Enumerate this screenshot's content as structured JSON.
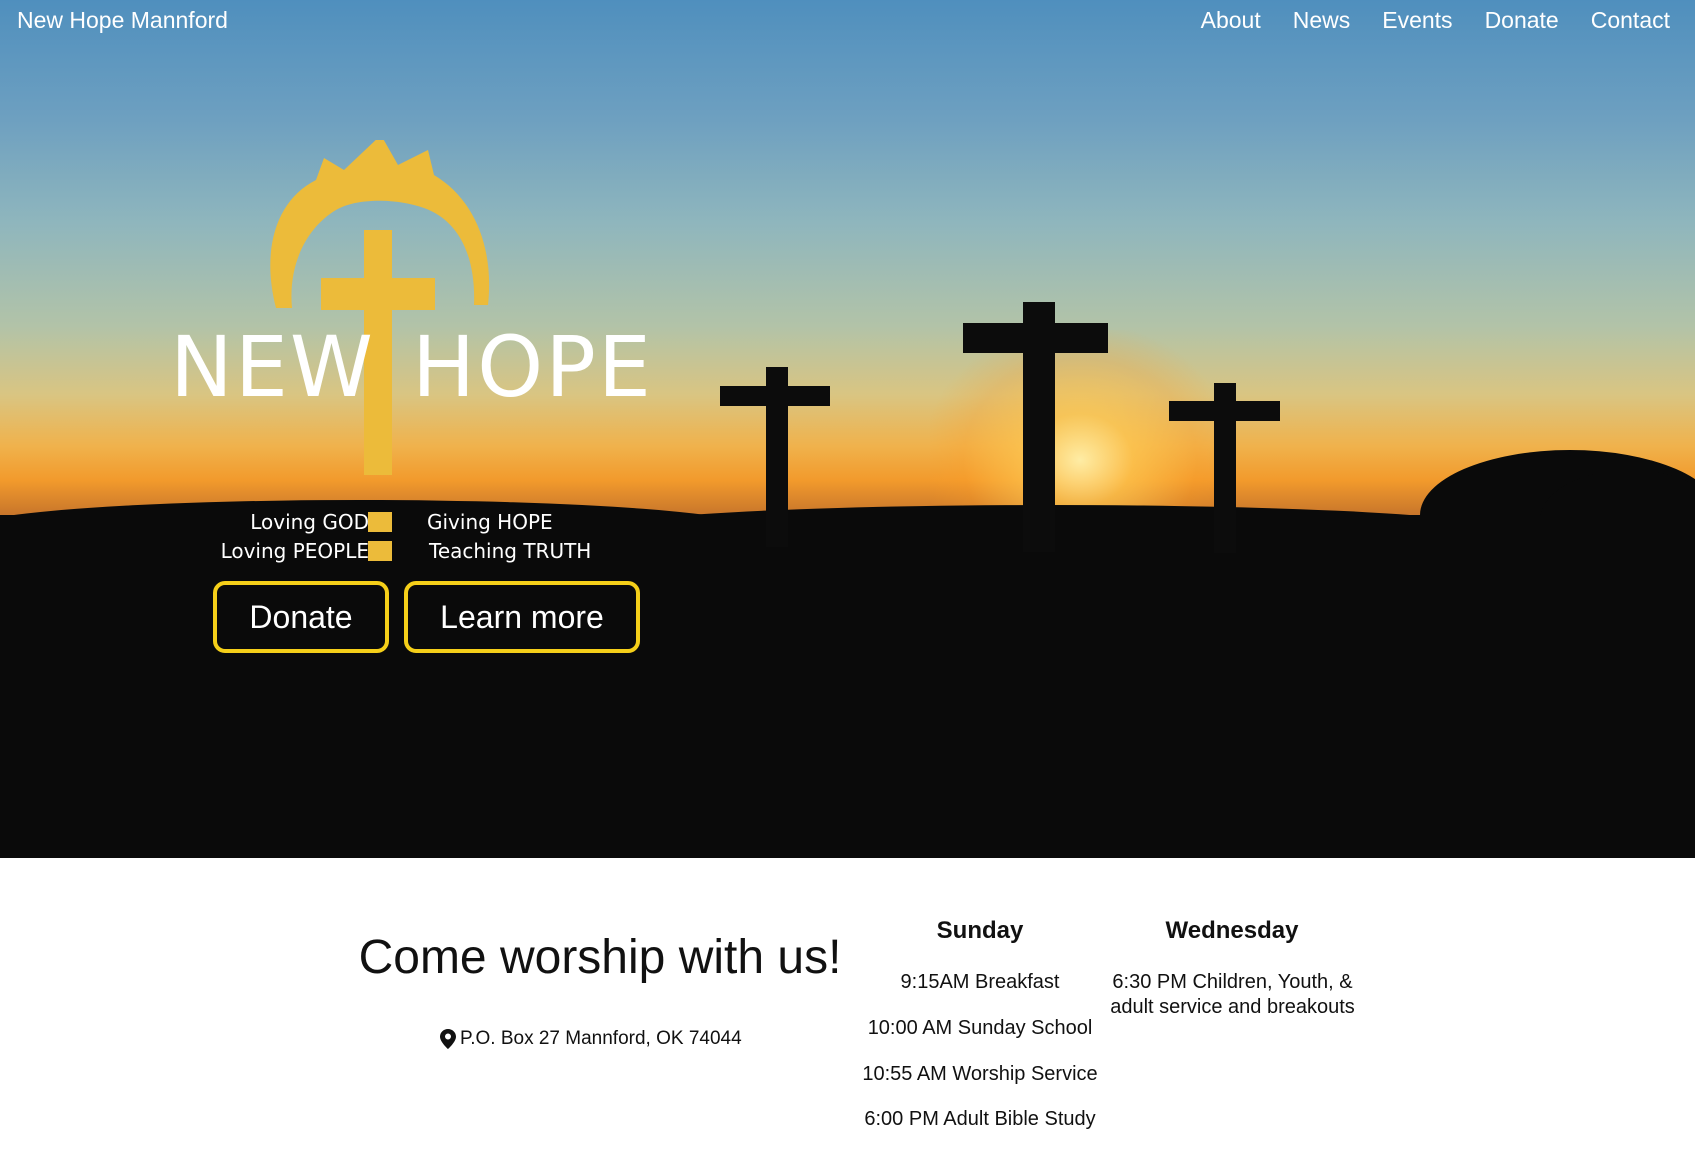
{
  "header": {
    "site_title": "New Hope Mannford",
    "nav": [
      "About",
      "News",
      "Events",
      "Donate",
      "Contact"
    ]
  },
  "logo": {
    "word_left": "NEW",
    "word_right": "HOPE",
    "tagline": {
      "line1_left": "Loving GOD",
      "line1_right": "Giving HOPE",
      "line2_left": "Loving PEOPLE",
      "line2_right": "Teaching TRUTH"
    }
  },
  "hero": {
    "buttons": {
      "donate": "Donate",
      "learn_more": "Learn more"
    }
  },
  "worship": {
    "title": "Come worship with us!",
    "address": "P.O. Box 27 Mannford, OK 74044",
    "sunday": {
      "heading": "Sunday",
      "items": [
        "9:15AM Breakfast",
        "10:00 AM Sunday School",
        "10:55 AM Worship Service",
        "6:00 PM Adult Bible Study"
      ]
    },
    "wednesday": {
      "heading": "Wednesday",
      "items": [
        "6:30 PM Children, Youth, & adult service and breakouts"
      ]
    }
  },
  "colors": {
    "accent_gold": "#ecbb3a",
    "button_border": "#f5cf19",
    "hero_ground": "#0a0a0a"
  },
  "icons": [
    "map-marker-icon",
    "sun-rays-icon",
    "cross-icon"
  ]
}
